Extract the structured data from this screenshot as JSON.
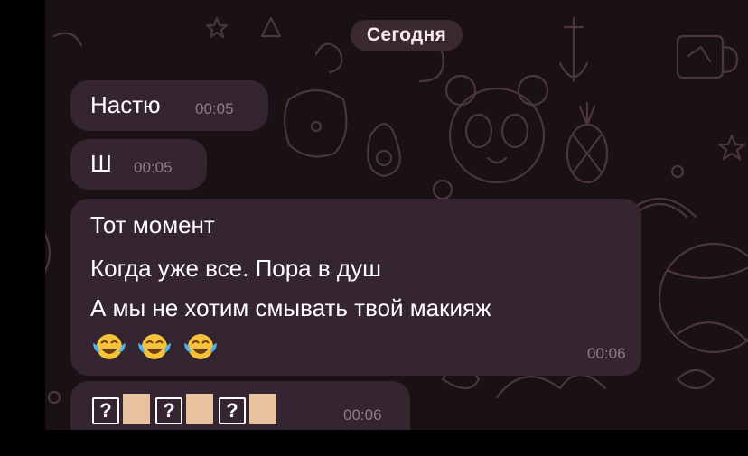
{
  "chat": {
    "date_separator": "Сегодня",
    "messages": [
      {
        "text": "Настю",
        "time": "00:05"
      },
      {
        "text": "Ш",
        "time": "00:05"
      },
      {
        "lines": [
          "Тот момент",
          "Когда уже все. Пора в душ",
          "А мы не хотим смывать твой макияж"
        ],
        "emoji": [
          "face-with-tears-of-joy",
          "face-with-tears-of-joy",
          "face-with-tears-of-joy"
        ],
        "time": "00:06"
      },
      {
        "glyphs": [
          "?",
          "skin-tone",
          "?",
          "skin-tone",
          "?",
          "skin-tone"
        ],
        "time": "00:06"
      }
    ]
  },
  "colors": {
    "background": "#1a1115",
    "bubble": "#352530",
    "timestamp": "#8e7f86",
    "pattern": "#4b363c"
  }
}
